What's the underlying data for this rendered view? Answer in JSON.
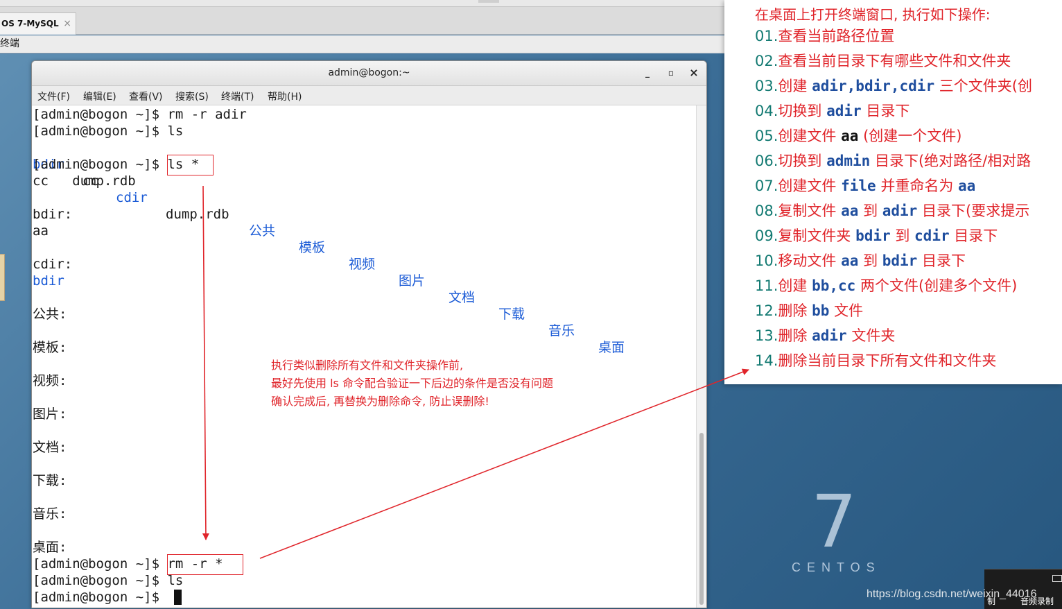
{
  "vm": {
    "tab_label": "OS 7-MySQL",
    "tab_close": "×",
    "sub_label": "终端"
  },
  "desktop": {
    "logo_number": "7",
    "logo_word": "CENTOS",
    "corner_label_left": "制",
    "corner_label_right": "音频录制"
  },
  "terminal": {
    "title": "admin@bogon:~",
    "window_buttons": {
      "minimize": "_",
      "maximize": "▫",
      "close": "×"
    },
    "menu": [
      "文件(F)",
      "编辑(E)",
      "查看(V)",
      "搜索(S)",
      "终端(T)",
      "帮助(H)"
    ],
    "prompt": "[admin@bogon ~]$",
    "lines": {
      "l1_cmd": "rm -r adir",
      "l2_cmd": "ls",
      "ls_dirs": [
        "bdir",
        "cdir",
        "公共",
        "模板",
        "视频",
        "图片",
        "文档",
        "下载",
        "音乐",
        "桌面"
      ],
      "ls_files": [
        "cc",
        "dump.rdb"
      ],
      "l4_cmd": "ls *",
      "l5": "cc   dump.rdb",
      "bdir_h": "bdir:",
      "bdir_c": "aa",
      "cdir_h": "cdir:",
      "cdir_c": "bdir",
      "d1": "公共:",
      "d2": "模板:",
      "d3": "视频:",
      "d4": "图片:",
      "d5": "文档:",
      "d6": "下载:",
      "d7": "音乐:",
      "d8": "桌面:",
      "l_rm": "rm -r *",
      "l_ls": "ls"
    }
  },
  "annotation": {
    "line1": "执行类似删除所有文件和文件夹操作前,",
    "line2": "最好先使用 ls 命令配合验证一下后边的条件是否没有问题",
    "line3": "确认完成后, 再替换为删除命令, 防止误删除!",
    "color": "#e0242a"
  },
  "tasks": {
    "heading": "在桌面上打开终端窗口, 执行如下操作:",
    "items": [
      {
        "num": "01.",
        "a": "查看当前路径位置"
      },
      {
        "num": "02.",
        "a": "查看当前目录下有哪些文件和文件夹"
      },
      {
        "num": "03.",
        "a": "创建 ",
        "cmd": "adir,bdir,cdir",
        "b": " 三个文件夹(创"
      },
      {
        "num": "04.",
        "a": "切换到 ",
        "cmd": "adir",
        "b": " 目录下"
      },
      {
        "num": "05.",
        "a": "创建文件 ",
        "cmd_dk": "aa",
        "b": " (创建一个文件)"
      },
      {
        "num": "06.",
        "a": "切换到 ",
        "cmd": "admin",
        "b": " 目录下(绝对路径/相对路"
      },
      {
        "num": "07.",
        "a": "创建文件 ",
        "cmd": "file",
        "b": " 并重命名为 ",
        "cmd2": "aa"
      },
      {
        "num": "08.",
        "a": "复制文件 ",
        "cmd": "aa",
        "b": " 到 ",
        "cmd2": "adir",
        "c": " 目录下(要求提示"
      },
      {
        "num": "09.",
        "a": "复制文件夹 ",
        "cmd": "bdir",
        "b": " 到 ",
        "cmd2": "cdir",
        "c": " 目录下"
      },
      {
        "num": "10.",
        "a": "移动文件 ",
        "cmd": "aa",
        "b": " 到 ",
        "cmd2": "bdir",
        "c": " 目录下"
      },
      {
        "num": "11.",
        "a": "创建 ",
        "cmd": "bb,cc",
        "b": " 两个文件(创建多个文件)"
      },
      {
        "num": "12.",
        "a": "删除 ",
        "cmd": "bb",
        "b": " 文件"
      },
      {
        "num": "13.",
        "a": "删除 ",
        "cmd": "adir",
        "b": " 文件夹"
      },
      {
        "num": "14.",
        "a": "删除当前目录下所有文件和文件夹"
      }
    ]
  },
  "watermark": "https://blog.csdn.net/weixin_44016"
}
